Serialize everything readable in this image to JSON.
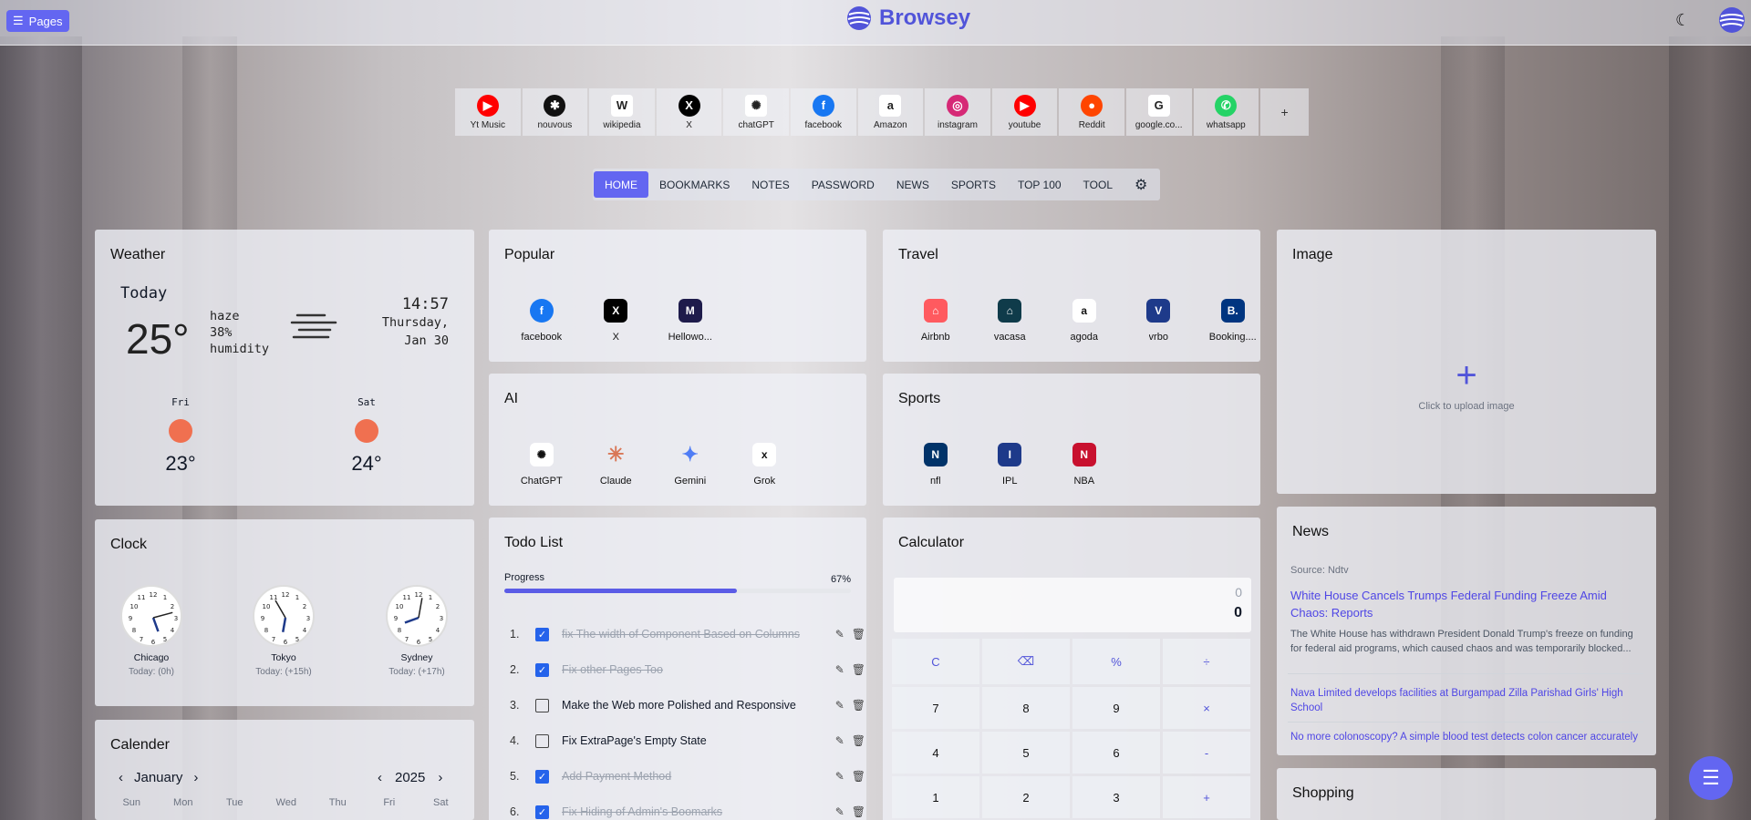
{
  "topbar": {
    "pages_label": "Pages",
    "brand": "Browsey"
  },
  "shortcuts": [
    {
      "label": "Yt Music",
      "icon": "ytmusic-icon",
      "color": "#ff0000",
      "glyph": "▶"
    },
    {
      "label": "nouvous",
      "icon": "nouvous-icon",
      "color": "#111111",
      "glyph": "✱"
    },
    {
      "label": "wikipedia",
      "icon": "wikipedia-icon",
      "color": "#ffffff",
      "glyph": "W"
    },
    {
      "label": "X",
      "icon": "x-icon",
      "color": "#000000",
      "glyph": "X"
    },
    {
      "label": "chatGPT",
      "icon": "chatgpt-icon",
      "color": "#ffffff",
      "glyph": "✺"
    },
    {
      "label": "facebook",
      "icon": "facebook-icon",
      "color": "#1877f2",
      "glyph": "f"
    },
    {
      "label": "Amazon",
      "icon": "amazon-icon",
      "color": "#ffffff",
      "glyph": "a"
    },
    {
      "label": "instagram",
      "icon": "instagram-icon",
      "color": "#d62976",
      "glyph": "◎"
    },
    {
      "label": "youtube",
      "icon": "youtube-icon",
      "color": "#ff0000",
      "glyph": "▶"
    },
    {
      "label": "Reddit",
      "icon": "reddit-icon",
      "color": "#ff4500",
      "glyph": "●"
    },
    {
      "label": "google.co...",
      "icon": "google-icon",
      "color": "#ffffff",
      "glyph": "G"
    },
    {
      "label": "whatsapp",
      "icon": "whatsapp-icon",
      "color": "#25d366",
      "glyph": "✆"
    }
  ],
  "add_shortcut": "+",
  "nav": [
    "HOME",
    "BOOKMARKS",
    "NOTES",
    "PASSWORD",
    "NEWS",
    "SPORTS",
    "TOP 100",
    "TOOL"
  ],
  "weather": {
    "title": "Weather",
    "today": "Today",
    "temp": "25°",
    "cond": "haze",
    "humidity": "38%",
    "humidity_label": "humidity",
    "time": "14:57",
    "day": "Thursday,",
    "date": "Jan 30",
    "forecast": [
      {
        "day": "Fri",
        "temp": "23°"
      },
      {
        "day": "Sat",
        "temp": "24°"
      }
    ]
  },
  "popular": {
    "title": "Popular",
    "items": [
      {
        "label": "facebook",
        "color": "#1877f2",
        "glyph": "f"
      },
      {
        "label": "X",
        "color": "#000000",
        "glyph": "X"
      },
      {
        "label": "Hellowo...",
        "color": "#1e1b4b",
        "glyph": "M"
      }
    ]
  },
  "travel": {
    "title": "Travel",
    "items": [
      {
        "label": "Airbnb",
        "color": "#ff5a5f",
        "glyph": "⌂"
      },
      {
        "label": "vacasa",
        "color": "#0f3b4a",
        "glyph": "⌂"
      },
      {
        "label": "agoda",
        "color": "#ffffff",
        "glyph": "a"
      },
      {
        "label": "vrbo",
        "color": "#1e3a8a",
        "glyph": "V"
      },
      {
        "label": "Booking....",
        "color": "#003580",
        "glyph": "B."
      }
    ]
  },
  "image": {
    "title": "Image",
    "hint": "Click to upload image"
  },
  "ai": {
    "title": "AI",
    "items": [
      {
        "label": "ChatGPT",
        "color": "#ffffff",
        "glyph": "✺"
      },
      {
        "label": "Claude",
        "color": "transparent",
        "glyph": "✳"
      },
      {
        "label": "Gemini",
        "color": "transparent",
        "glyph": "✦"
      },
      {
        "label": "Grok",
        "color": "#ffffff",
        "glyph": "x"
      }
    ]
  },
  "sports": {
    "title": "Sports",
    "items": [
      {
        "label": "nfl",
        "color": "#013369",
        "glyph": "N"
      },
      {
        "label": "IPL",
        "color": "#1e3a8a",
        "glyph": "I"
      },
      {
        "label": "NBA",
        "color": "#c8102e",
        "glyph": "N"
      }
    ]
  },
  "clock": {
    "title": "Clock",
    "cities": [
      {
        "name": "Chicago",
        "offset": "Today: (0h)"
      },
      {
        "name": "Tokyo",
        "offset": "Today: (+15h)"
      },
      {
        "name": "Sydney",
        "offset": "Today: (+17h)"
      }
    ]
  },
  "todo": {
    "title": "Todo List",
    "progress_label": "Progress",
    "progress": 0.67,
    "progress_text": "67%",
    "items": [
      {
        "n": "1.",
        "text": "fix The width of Component Based on Columns",
        "done": true
      },
      {
        "n": "2.",
        "text": "Fix other Pages Too",
        "done": true
      },
      {
        "n": "3.",
        "text": "Make the Web more Polished and Responsive",
        "done": false
      },
      {
        "n": "4.",
        "text": "Fix ExtraPage's Empty State",
        "done": false
      },
      {
        "n": "5.",
        "text": "Add Payment Method",
        "done": true
      },
      {
        "n": "6.",
        "text": "Fix Hiding of Admin's Boomarks",
        "done": true
      }
    ]
  },
  "calculator": {
    "title": "Calculator",
    "expr": "0",
    "result": "0",
    "keys": [
      "C",
      "⌫",
      "%",
      "÷",
      "7",
      "8",
      "9",
      "×",
      "4",
      "5",
      "6",
      "-",
      "1",
      "2",
      "3",
      "+"
    ]
  },
  "news": {
    "title": "News",
    "source": "Source: Ndtv",
    "headline": "White House Cancels Trumps Federal Funding Freeze Amid Chaos: Reports",
    "summary": "The White House has withdrawn President Donald Trump's freeze on funding for federal aid programs, which caused chaos and was temporarily blocked...",
    "links": [
      "Nava Limited develops facilities at Burgampad Zilla Parishad Girls' High School",
      "No more colonoscopy? A simple blood test detects colon cancer accurately"
    ]
  },
  "calendar": {
    "title": "Calender",
    "month": "January",
    "year": "2025",
    "weekdays": [
      "Sun",
      "Mon",
      "Tue",
      "Wed",
      "Thu",
      "Fri",
      "Sat"
    ]
  },
  "shopping": {
    "title": "Shopping"
  }
}
